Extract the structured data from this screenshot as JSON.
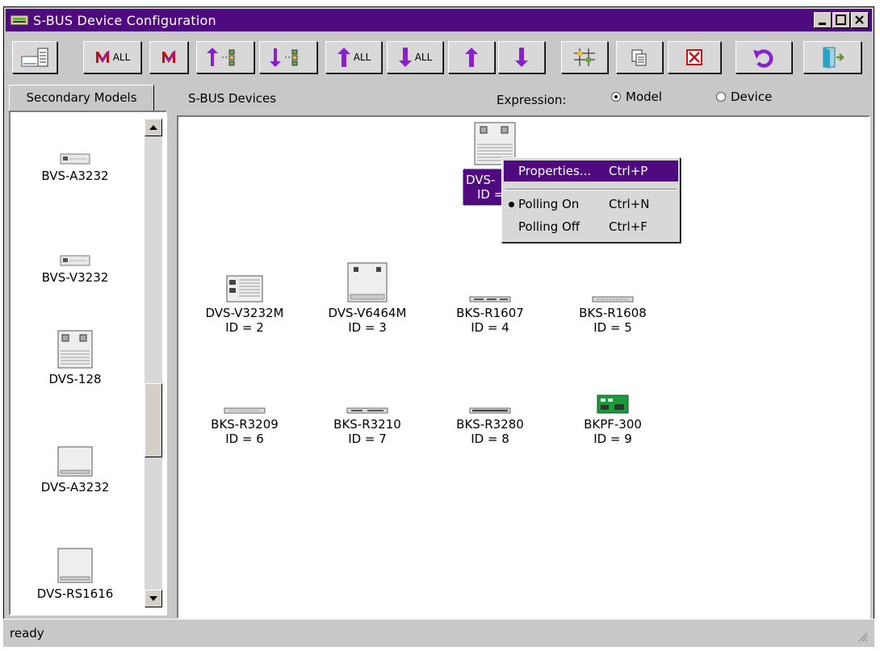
{
  "window": {
    "title": "S-BUS Device Configuration"
  },
  "tabs": {
    "secondary_models": "Secondary Models"
  },
  "main": {
    "section_label": "S-BUS Devices",
    "expression_label": "Expression:",
    "radio_model": "Model",
    "radio_device": "Device",
    "selected_model": "Model"
  },
  "secondary_models": [
    {
      "name": "BVS-A3232"
    },
    {
      "name": "BVS-V3232"
    },
    {
      "name": "DVS-128"
    },
    {
      "name": "DVS-A3232"
    },
    {
      "name": "DVS-RS1616"
    }
  ],
  "devices": [
    {
      "name": "DVS-V3232M",
      "id": "ID = 2"
    },
    {
      "name": "DVS-V6464M",
      "id": "ID = 3"
    },
    {
      "name": "BKS-R1607",
      "id": "ID = 4"
    },
    {
      "name": "BKS-R1608",
      "id": "ID = 5"
    },
    {
      "name": "BKS-R3209",
      "id": "ID = 6"
    },
    {
      "name": "BKS-R3210",
      "id": "ID = 7"
    },
    {
      "name": "BKS-R3280",
      "id": "ID = 8"
    },
    {
      "name": "BKPF-300",
      "id": "ID = 9"
    }
  ],
  "selected_device": {
    "name": "DVS-",
    "id": "ID ="
  },
  "context_menu": [
    {
      "label": "Properties...",
      "shortcut": "Ctrl+P"
    },
    {
      "label": "Polling On",
      "shortcut": "Ctrl+N"
    },
    {
      "label": "Polling Off",
      "shortcut": "Ctrl+F"
    }
  ],
  "status": {
    "text": "ready"
  },
  "colors": {
    "accent": "#4f0a7f",
    "arrow": "#8a1fd0",
    "delete": "#d01010"
  },
  "toolbar": {
    "all_label_1": "ALL",
    "all_label_2": "ALL",
    "all_label_3": "ALL"
  }
}
